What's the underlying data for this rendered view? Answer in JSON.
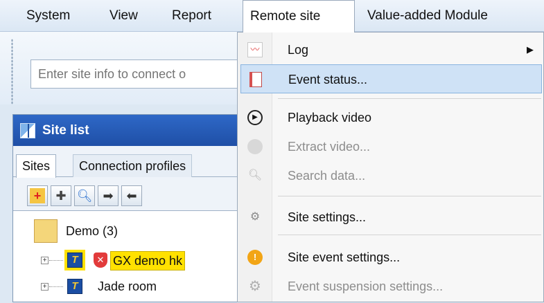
{
  "menubar": {
    "items": [
      {
        "label": "System"
      },
      {
        "label": "View"
      },
      {
        "label": "Report"
      },
      {
        "label": "Remote site"
      },
      {
        "label": "Value-added Module"
      }
    ]
  },
  "toolbar": {
    "connect_placeholder": "Enter site info to connect o"
  },
  "site_list": {
    "title": "Site list",
    "tabs": [
      "Sites",
      "Connection profiles"
    ],
    "buttons": [
      "add-site-icon",
      "edit-site-icon",
      "search-icon",
      "arrow-right-icon",
      "arrow-left-icon"
    ],
    "tree": {
      "group_label": "Demo (3)",
      "items": [
        {
          "label": "GX demo hk",
          "highlighted": true
        },
        {
          "label": "Jade room",
          "highlighted": false
        }
      ]
    }
  },
  "remote_site_menu": {
    "items": [
      {
        "label": "Log",
        "icon": "log-chart-icon",
        "enabled": true,
        "submenu": true
      },
      {
        "label": "Event status...",
        "icon": "event-status-icon",
        "enabled": true,
        "highlighted": true
      },
      {
        "label": "Playback video",
        "icon": "play-circle-icon",
        "enabled": true
      },
      {
        "label": "Extract video...",
        "icon": "disc-icon",
        "enabled": false
      },
      {
        "label": "Search data...",
        "icon": "magnifier-icon",
        "enabled": false
      },
      {
        "label": "Site settings...",
        "icon": "gear-wrench-icon",
        "enabled": true
      },
      {
        "label": "Site event settings...",
        "icon": "alert-icon",
        "enabled": true
      },
      {
        "label": "Event suspension settings...",
        "icon": "gear-icon",
        "enabled": false
      }
    ]
  },
  "colors": {
    "panel_header": "#2e68c7",
    "menu_highlight": "#cfe2f6",
    "tree_highlight": "#ffe100"
  }
}
